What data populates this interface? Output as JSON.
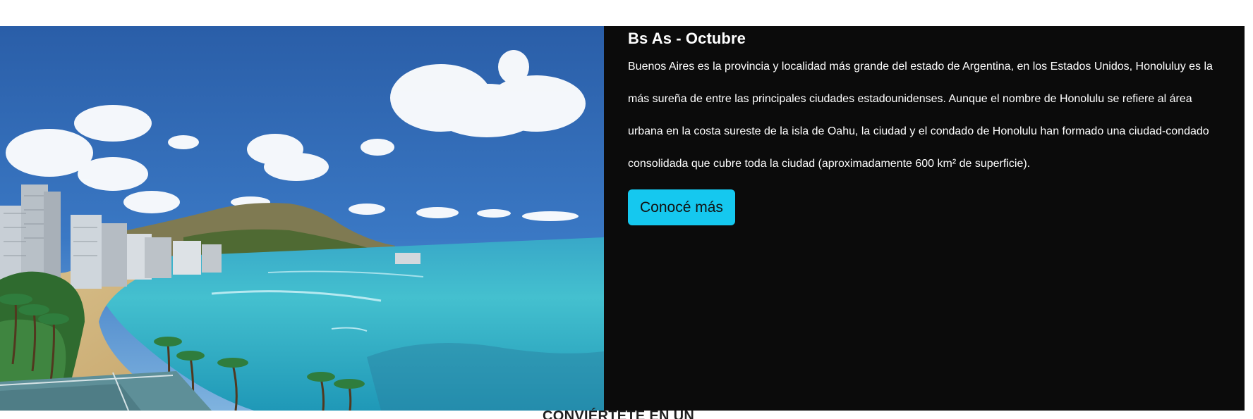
{
  "hero": {
    "image_alt": "Honolulu beach skyline",
    "title": "Bs As - Octubre",
    "description": "Buenos Aires es la provincia y localidad más grande del estado de Argentina, en los Estados Unidos, Honoluluy es la más sureña de entre las principales ciudades estadounidenses. Aunque el nombre de Honolulu se refiere al área urbana en la costa sureste de la isla de Oahu, la ciudad y el condado de Honolulu han formado una ciudad-condado consolidada que cubre toda la ciudad (aproximadamente 600 km² de superficie).",
    "cta_label": "Conocé más",
    "colors": {
      "panel_background": "#0b0b0b",
      "cta_background": "#15c8ef",
      "cta_text": "#111111"
    }
  },
  "next_section": {
    "heading": "CONVIÉRTETE EN UN"
  }
}
